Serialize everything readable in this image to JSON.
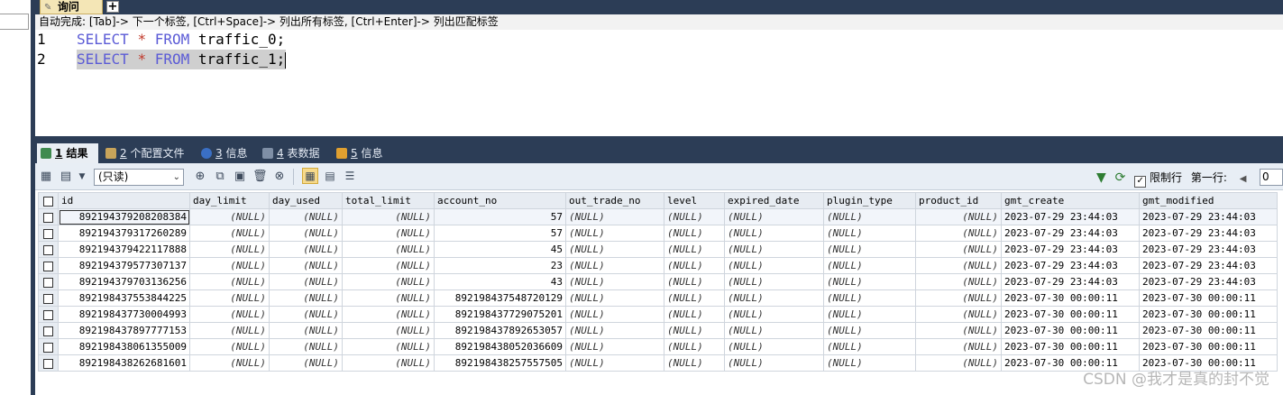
{
  "query_tab": {
    "label": "询问"
  },
  "autocomplete_hint": "自动完成: [Tab]-> 下一个标签, [Ctrl+Space]-> 列出所有标签, [Ctrl+Enter]-> 列出匹配标签",
  "editor": {
    "lines": [
      {
        "num": "1",
        "kw1": "SELECT",
        "op": "*",
        "kw2": "FROM",
        "rest": "traffic_0;"
      },
      {
        "num": "2",
        "kw1": "SELECT",
        "op": "*",
        "kw2": "FROM",
        "rest": "traffic_1;"
      }
    ]
  },
  "result_tabs": [
    {
      "num": "1",
      "label": "结果"
    },
    {
      "num": "2",
      "label": "个配置文件"
    },
    {
      "num": "3",
      "label": "信息"
    },
    {
      "num": "4",
      "label": "表数据"
    },
    {
      "num": "5",
      "label": "信息"
    }
  ],
  "toolbar": {
    "readonly_select": "(只读)",
    "limit_label": "限制行",
    "first_row_label": "第一行:",
    "first_row_value": "0"
  },
  "grid": {
    "columns": [
      "id",
      "day_limit",
      "day_used",
      "total_limit",
      "account_no",
      "out_trade_no",
      "level",
      "expired_date",
      "plugin_type",
      "product_id",
      "gmt_create",
      "gmt_modified"
    ],
    "null_text": "(NULL)",
    "rows": [
      {
        "id": "892194379208208384",
        "account_no": "57",
        "gmt_create": "2023-07-29 23:44:03",
        "gmt_modified": "2023-07-29 23:44:03"
      },
      {
        "id": "892194379317260289",
        "account_no": "57",
        "gmt_create": "2023-07-29 23:44:03",
        "gmt_modified": "2023-07-29 23:44:03"
      },
      {
        "id": "892194379422117888",
        "account_no": "45",
        "gmt_create": "2023-07-29 23:44:03",
        "gmt_modified": "2023-07-29 23:44:03"
      },
      {
        "id": "892194379577307137",
        "account_no": "23",
        "gmt_create": "2023-07-29 23:44:03",
        "gmt_modified": "2023-07-29 23:44:03"
      },
      {
        "id": "892194379703136256",
        "account_no": "43",
        "gmt_create": "2023-07-29 23:44:03",
        "gmt_modified": "2023-07-29 23:44:03"
      },
      {
        "id": "892198437553844225",
        "account_no": "892198437548720129",
        "gmt_create": "2023-07-30 00:00:11",
        "gmt_modified": "2023-07-30 00:00:11"
      },
      {
        "id": "892198437730004993",
        "account_no": "892198437729075201",
        "gmt_create": "2023-07-30 00:00:11",
        "gmt_modified": "2023-07-30 00:00:11"
      },
      {
        "id": "892198437897777153",
        "account_no": "892198437892653057",
        "gmt_create": "2023-07-30 00:00:11",
        "gmt_modified": "2023-07-30 00:00:11"
      },
      {
        "id": "892198438061355009",
        "account_no": "892198438052036609",
        "gmt_create": "2023-07-30 00:00:11",
        "gmt_modified": "2023-07-30 00:00:11"
      },
      {
        "id": "892198438262681601",
        "account_no": "892198438257557505",
        "gmt_create": "2023-07-30 00:00:11",
        "gmt_modified": "2023-07-30 00:00:11"
      }
    ]
  },
  "watermark": "CSDN @我才是真的封不觉"
}
